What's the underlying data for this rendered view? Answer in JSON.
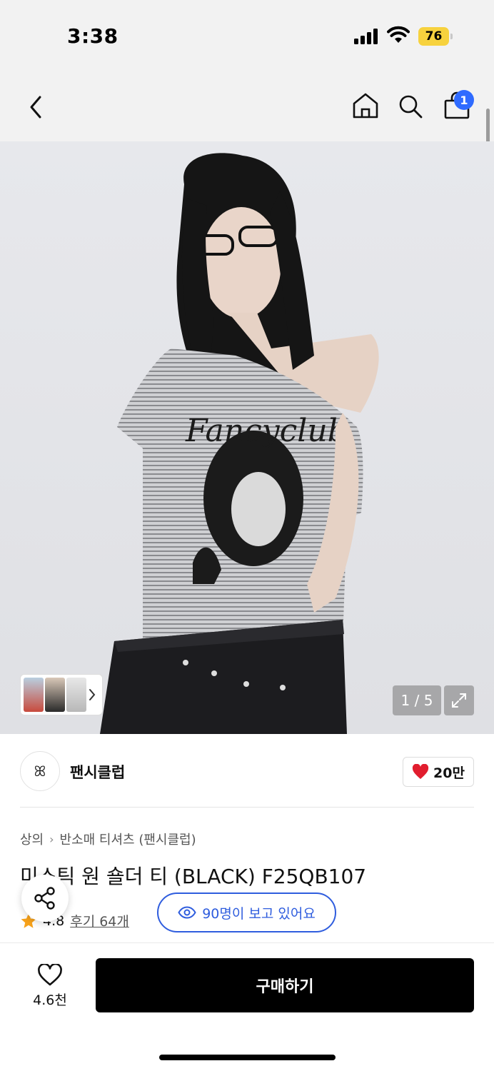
{
  "status_bar": {
    "time": "3:38",
    "battery": "76",
    "icons": [
      "signal-icon",
      "wifi-icon",
      "battery-icon"
    ]
  },
  "nav": {
    "icons": [
      "back-chevron-icon",
      "home-icon",
      "search-icon",
      "cart-icon"
    ],
    "cart_badge": "1"
  },
  "hero": {
    "pager": "1 / 5",
    "image_description": "product-photo",
    "accent": "#2f6bff"
  },
  "brand": {
    "name": "팬시클럽",
    "logo_text": "ꕤ",
    "likes": "20만"
  },
  "product": {
    "breadcrumb": [
      "상의",
      "반소매 티셔츠 (팬시클럽)"
    ],
    "title": "미스틱 원 숄더 티 (BLACK) F25QB107",
    "rating": "4.8",
    "reviews": "후기 64개",
    "viewers": "90명이 보고 있어요"
  },
  "bottom_bar": {
    "wish_count": "4.6천",
    "buy_label": "구매하기"
  },
  "colors": {
    "brand_blue": "#2f5dde",
    "heart_red": "#e11d2e",
    "star_orange": "#f7a21b",
    "battery_yellow": "#f7d23e"
  }
}
